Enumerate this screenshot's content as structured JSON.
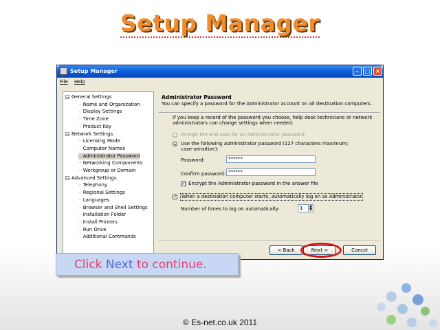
{
  "slide": {
    "title": "Setup Manager",
    "copyright": "© Es-net.co.uk 2011",
    "callout": {
      "before": "Click ",
      "accent_word": "Next",
      "after": " to continue."
    }
  },
  "window": {
    "title": "Setup Manager",
    "menu": [
      "File",
      "Help"
    ],
    "tree": [
      {
        "label": "General Settings",
        "level": 0,
        "expander": "−"
      },
      {
        "label": "Name and Organization",
        "level": 1
      },
      {
        "label": "Display Settings",
        "level": 1
      },
      {
        "label": "Time Zone",
        "level": 1
      },
      {
        "label": "Product Key",
        "level": 1
      },
      {
        "label": "Network Settings",
        "level": 0,
        "expander": "−"
      },
      {
        "label": "Licensing Mode",
        "level": 1
      },
      {
        "label": "Computer Names",
        "level": 1
      },
      {
        "label": "Administrator Password",
        "level": 1,
        "selected": true
      },
      {
        "label": "Networking Components",
        "level": 1
      },
      {
        "label": "Workgroup or Domain",
        "level": 1
      },
      {
        "label": "Advanced Settings",
        "level": 0,
        "expander": "−"
      },
      {
        "label": "Telephony",
        "level": 1
      },
      {
        "label": "Regional Settings",
        "level": 1
      },
      {
        "label": "Languages",
        "level": 1
      },
      {
        "label": "Browser and Shell Settings",
        "level": 1
      },
      {
        "label": "Installation Folder",
        "level": 1
      },
      {
        "label": "Install Printers",
        "level": 1
      },
      {
        "label": "Run Once",
        "level": 1
      },
      {
        "label": "Additional Commands",
        "level": 1
      }
    ],
    "page": {
      "header_title": "Administrator Password",
      "header_desc": "You can specify a password for the Administrator account on all destination computers.",
      "intro_line1": "If you keep a record of the password you choose, help desk technicians or network",
      "intro_line2": "administrators can change settings when needed.",
      "radio_prompt": "Prompt the end user for an Administrator password",
      "radio_use_line1": "Use the following Administrator password (127 characters maximum;",
      "radio_use_line2": "case-sensitive):",
      "password_label": "Password:",
      "password_value": "******",
      "confirm_label": "Confirm password:",
      "confirm_value": "******",
      "encrypt_label": "Encrypt the Administrator password in the answer file",
      "autologon_label": "When a destination computer starts, automatically log on as Administrator",
      "times_label": "Number of times to log on automatically:",
      "times_value": "1"
    },
    "buttons": {
      "back": "< Back",
      "next": "Next >",
      "cancel": "Cancel"
    }
  },
  "colors": {
    "title_orange": "#f08c2c",
    "titlebar_blue": "#0a5fd8",
    "highlight_red": "#d01818",
    "callout_bg": "#c8d8f4"
  }
}
